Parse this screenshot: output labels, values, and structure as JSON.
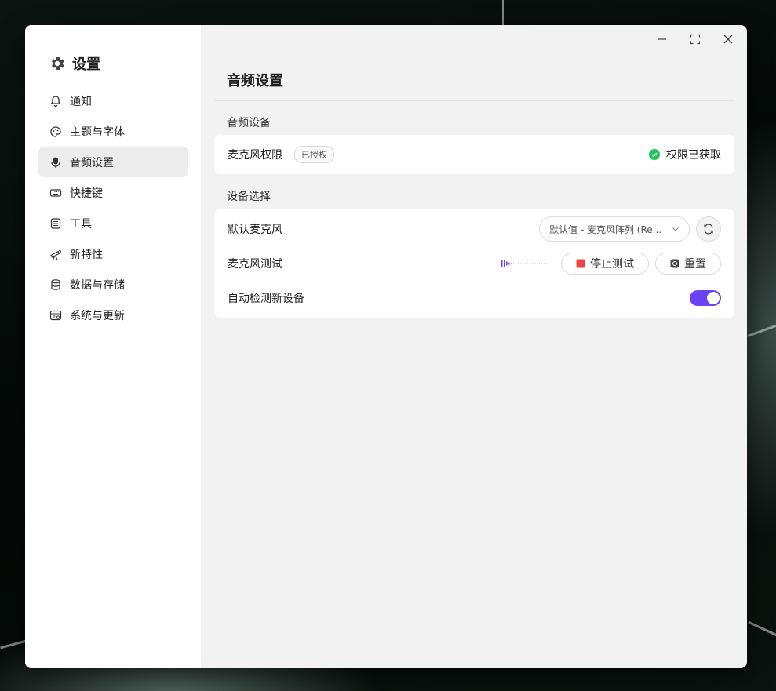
{
  "sidebar": {
    "title": "设置",
    "items": [
      {
        "label": "通知",
        "icon": "bell-icon"
      },
      {
        "label": "主题与字体",
        "icon": "palette-icon"
      },
      {
        "label": "音频设置",
        "icon": "microphone-icon",
        "active": true
      },
      {
        "label": "快捷键",
        "icon": "keyboard-icon"
      },
      {
        "label": "工具",
        "icon": "tools-icon"
      },
      {
        "label": "新特性",
        "icon": "telescope-icon"
      },
      {
        "label": "数据与存储",
        "icon": "database-icon"
      },
      {
        "label": "系统与更新",
        "icon": "system-icon"
      }
    ]
  },
  "main": {
    "title": "音频设置",
    "section_audio_device": "音频设备",
    "mic_permission": {
      "label": "麦克风权限",
      "badge": "已授权",
      "status": "权限已获取",
      "status_color": "#22c55e"
    },
    "section_device_select": "设备选择",
    "default_mic": {
      "label": "默认麦克风",
      "selected": "默认值 - 麦克风阵列 (Re..."
    },
    "mic_test": {
      "label": "麦克风测试",
      "stop_label": "停止测试",
      "reset_label": "重置",
      "stop_color": "#ef4444"
    },
    "auto_detect": {
      "label": "自动检测新设备",
      "enabled": true,
      "accent": "#6b42f5"
    }
  }
}
